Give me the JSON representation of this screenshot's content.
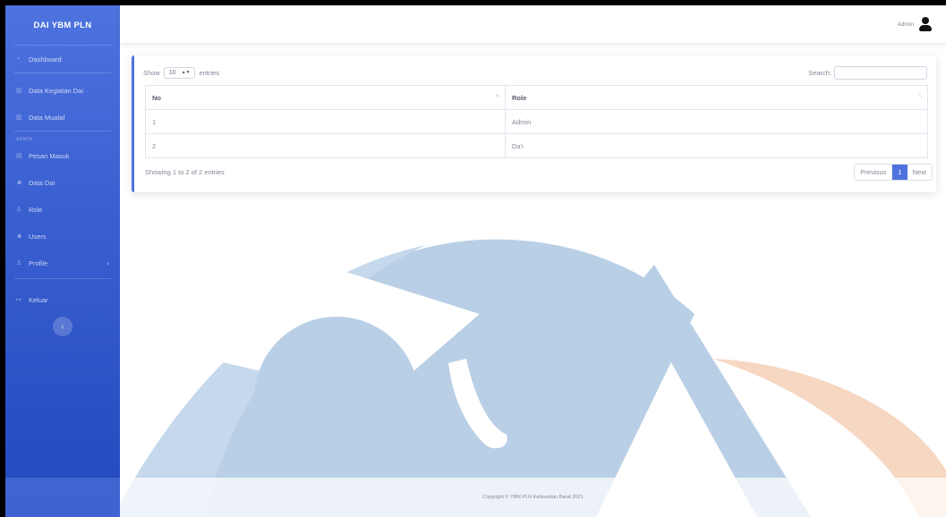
{
  "sidebar": {
    "brand": "DAI YBM PLN",
    "items": [
      {
        "icon": "dashboard-icon",
        "label": "Dashboard"
      },
      {
        "icon": "chart-icon",
        "label": "Data Kegiatan Dai"
      },
      {
        "icon": "chart-icon",
        "label": "Data Mualaf"
      }
    ],
    "section_heading": "ADMIN",
    "admin_items": [
      {
        "icon": "inbox-icon",
        "label": "Pesan Masuk"
      },
      {
        "icon": "users-icon",
        "label": "Data Dai"
      },
      {
        "icon": "user-icon",
        "label": "Role"
      },
      {
        "icon": "users-icon",
        "label": "Users"
      },
      {
        "icon": "user-icon",
        "label": "Profile"
      }
    ],
    "logout": {
      "icon": "logout-icon",
      "label": "Keluar"
    },
    "toggle_glyph": "‹"
  },
  "topbar": {
    "user_name": "Admin",
    "avatar_icon": "user-avatar-icon"
  },
  "table_controls": {
    "show_label": "Show",
    "entries_value": "10",
    "entries_label": "entries",
    "search_label": "Search:",
    "search_value": ""
  },
  "table": {
    "columns": [
      "No",
      "Role"
    ],
    "rows": [
      [
        "1",
        "Admin"
      ],
      [
        "2",
        "Da'i"
      ]
    ]
  },
  "pagination": {
    "info": "Showing 1 to 2 of 2 entries",
    "previous": "Previous",
    "current": "1",
    "next": "Next"
  },
  "footer": {
    "copyright": "Copyright © YBM PLN Kalimantan Barat 2021"
  },
  "colors": {
    "sidebar_top": "#4e73df",
    "sidebar_bottom": "#224abe",
    "accent": "#4e73df",
    "watermark_blue": "#b9cfe6",
    "watermark_orange": "#f6d7c2"
  }
}
